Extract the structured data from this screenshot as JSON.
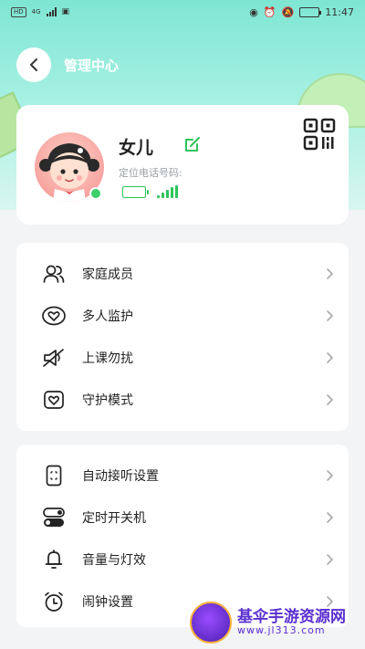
{
  "status_bar": {
    "left_chip": "HD",
    "network": "4G",
    "time": "11:47"
  },
  "header": {
    "title": "管理中心"
  },
  "profile": {
    "name": "女儿",
    "phone_label": "定位电话号码:"
  },
  "menu_group_1": [
    {
      "label": "家庭成员",
      "icon": "family-members-icon"
    },
    {
      "label": "多人监护",
      "icon": "heart-icon"
    },
    {
      "label": "上课勿扰",
      "icon": "mute-bell-icon"
    },
    {
      "label": "守护模式",
      "icon": "guard-heart-icon"
    }
  ],
  "menu_group_2": [
    {
      "label": "自动接听设置",
      "icon": "phone-device-icon"
    },
    {
      "label": "定时开关机",
      "icon": "toggle-switch-icon"
    },
    {
      "label": "音量与灯效",
      "icon": "bell-icon"
    },
    {
      "label": "闹钟设置",
      "icon": "alarm-clock-icon"
    }
  ],
  "watermark": {
    "title": "基伞手游资源网",
    "url": "www.jl313.com"
  },
  "colors": {
    "accent_green": "#2ec45c",
    "hero_teal": "#7ee6d2"
  }
}
